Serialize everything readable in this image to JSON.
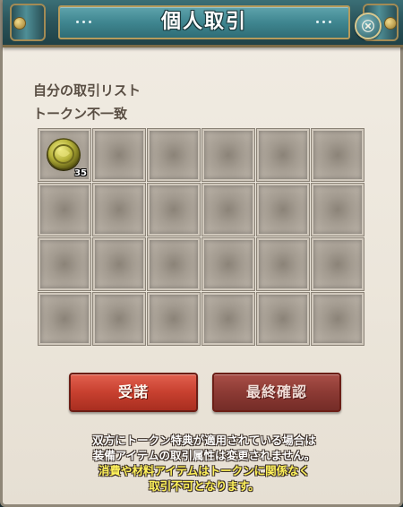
{
  "window": {
    "title": "個人取引",
    "close_icon": "close-icon"
  },
  "trade_list": {
    "heading": "自分の取引リスト",
    "status": "トークン不一致",
    "slots": [
      {
        "item": "gold-token-icon",
        "quantity": "35"
      },
      {
        "item": null,
        "quantity": null
      },
      {
        "item": null,
        "quantity": null
      },
      {
        "item": null,
        "quantity": null
      },
      {
        "item": null,
        "quantity": null
      },
      {
        "item": null,
        "quantity": null
      },
      {
        "item": null,
        "quantity": null
      },
      {
        "item": null,
        "quantity": null
      },
      {
        "item": null,
        "quantity": null
      },
      {
        "item": null,
        "quantity": null
      },
      {
        "item": null,
        "quantity": null
      },
      {
        "item": null,
        "quantity": null
      },
      {
        "item": null,
        "quantity": null
      },
      {
        "item": null,
        "quantity": null
      },
      {
        "item": null,
        "quantity": null
      },
      {
        "item": null,
        "quantity": null
      },
      {
        "item": null,
        "quantity": null
      },
      {
        "item": null,
        "quantity": null
      },
      {
        "item": null,
        "quantity": null
      },
      {
        "item": null,
        "quantity": null
      },
      {
        "item": null,
        "quantity": null
      },
      {
        "item": null,
        "quantity": null
      },
      {
        "item": null,
        "quantity": null
      },
      {
        "item": null,
        "quantity": null
      }
    ]
  },
  "buttons": {
    "accept_label": "受諾",
    "final_confirm_label": "最終確認"
  },
  "notice": {
    "line1": "双方にトークン特典が適用されている場合は",
    "line2": "装備アイテムの取引属性は変更されません。",
    "line3": "消費や材料アイテムはトークンに関係なく",
    "line4": "取引不可となります。"
  },
  "colors": {
    "title_bar": "#2f6d76",
    "accept_button": "#c7402f",
    "final_button": "#8c3a34",
    "notice_highlight": "#fff25a"
  }
}
